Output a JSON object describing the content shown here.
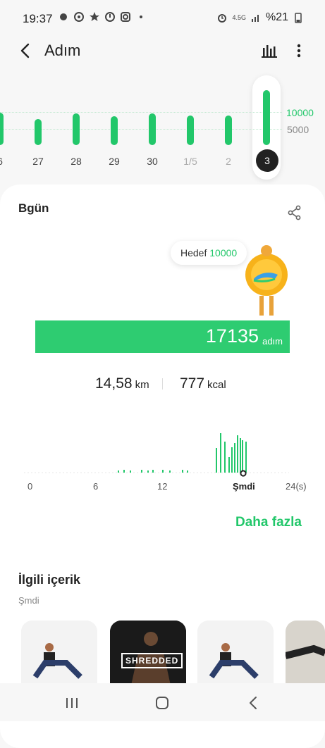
{
  "status_bar": {
    "time": "19:37",
    "network": "4.5G",
    "battery": "%21"
  },
  "header": {
    "title": "Adım"
  },
  "weekly_chart": {
    "goal_label": "10000",
    "mid_label": "5000",
    "days": [
      {
        "label": "6",
        "value": 10000
      },
      {
        "label": "27",
        "value": 8200
      },
      {
        "label": "28",
        "value": 9800
      },
      {
        "label": "29",
        "value": 9000
      },
      {
        "label": "30",
        "value": 9800
      },
      {
        "label": "1/5",
        "value": 9300
      },
      {
        "label": "2",
        "value": 9300
      },
      {
        "label": "3",
        "value": 17135,
        "selected": true
      }
    ]
  },
  "today": {
    "title": "Bgün",
    "goal_prefix": "Hedef",
    "goal_value": "10000",
    "steps": "17135",
    "steps_unit": "adım",
    "distance": "14,58",
    "distance_unit": "km",
    "calories": "777",
    "calories_unit": "kcal"
  },
  "hourly_chart": {
    "x_labels": [
      "0",
      "6",
      "12",
      "Şmdi",
      "24(s)"
    ]
  },
  "more_link": "Daha fazla",
  "related": {
    "title": "İlgili içerik",
    "subtitle": "Şmdi",
    "items": [
      {
        "caption": ""
      },
      {
        "caption": "SHREDDED"
      },
      {
        "caption": ""
      },
      {
        "caption": ""
      }
    ]
  },
  "colors": {
    "accent": "#22c76a",
    "text": "#222222"
  }
}
